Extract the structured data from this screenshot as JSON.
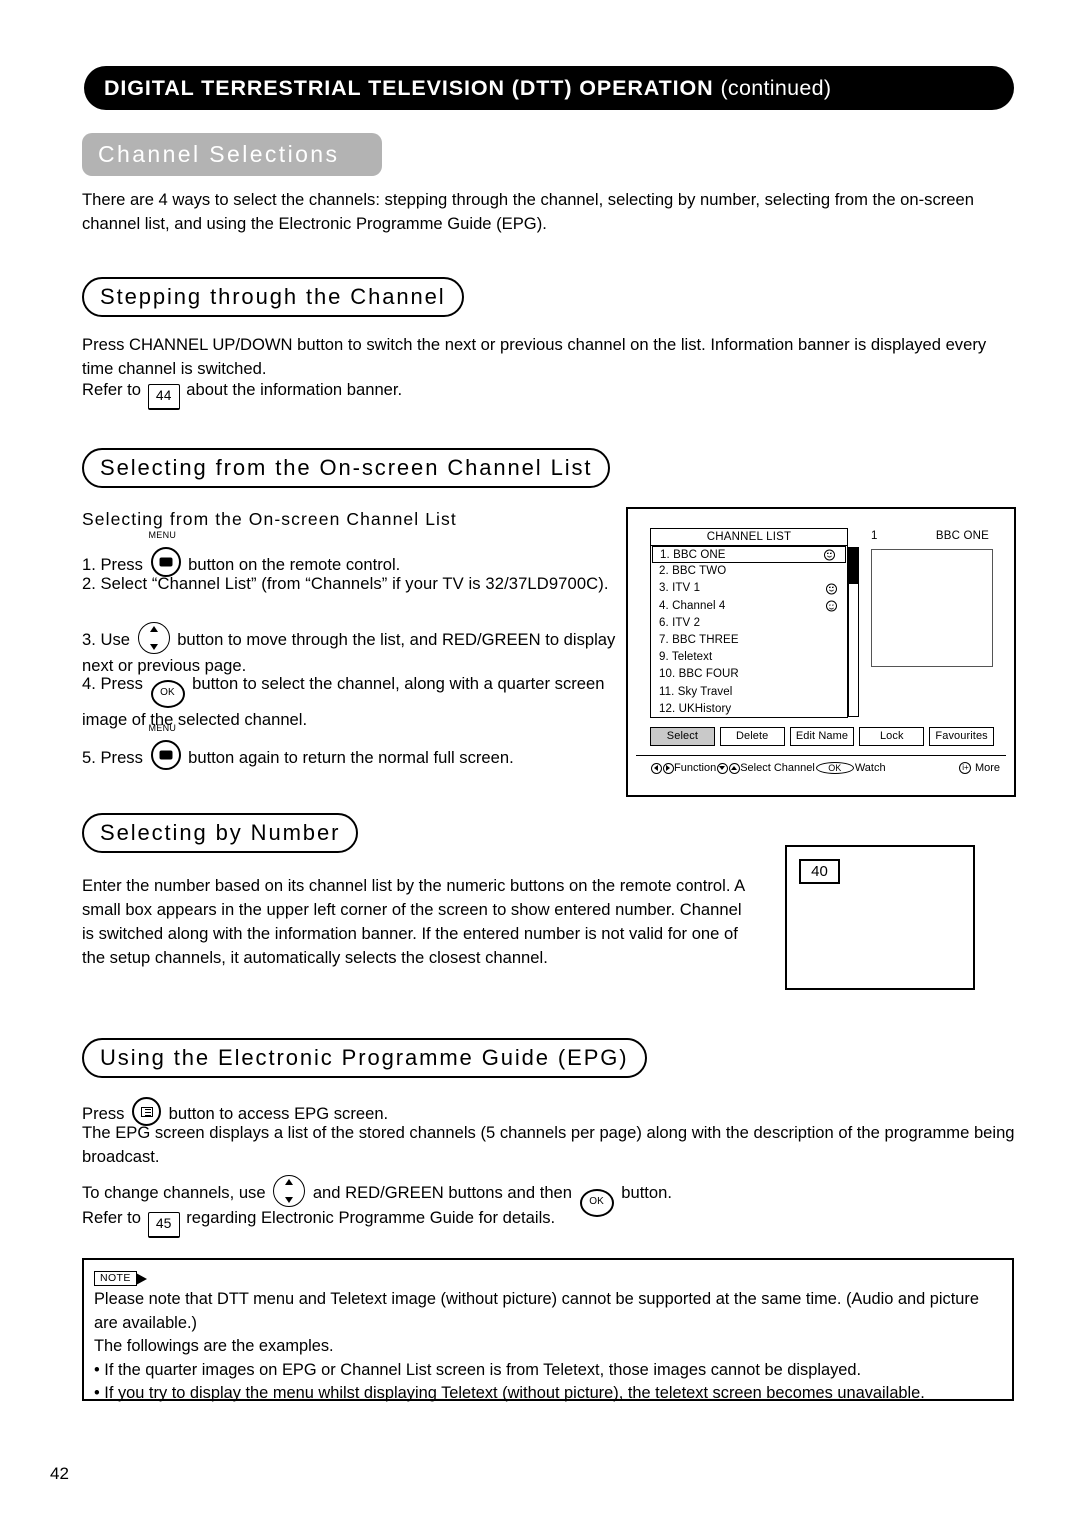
{
  "header": {
    "title_main": "DIGITAL TERRESTRIAL TELEVISION (DTT) OPERATION ",
    "title_tail": "(continued)"
  },
  "gray_heading": "Channel Selections",
  "intro": "There are 4 ways to select the channels: stepping through the channel, selecting by number, selecting from the on-screen channel list, and using the Electronic Programme Guide (EPG).",
  "sections": {
    "stepping": {
      "heading": "Stepping through the Channel",
      "para1": "Press CHANNEL UP/DOWN button to switch the next or previous channel on the list. Information banner is displayed every time channel is switched.",
      "refer_prefix": "Refer to ",
      "refer_page": "44",
      "refer_suffix": " about the information banner."
    },
    "onscreen": {
      "heading": "Selecting from the On-screen Channel List",
      "subheading": "Selecting from the On-screen Channel List",
      "steps": [
        {
          "num": "1.",
          "pre": "Press ",
          "icon": "menu-button-icon",
          "icon_caption": "MENU",
          "post": " button on the remote control."
        },
        {
          "num": "2.",
          "pre": "Select “Channel List” (from “Channels” if your TV is 32/37LD9700C).",
          "icon": "",
          "post": ""
        },
        {
          "num": "3.",
          "pre": "Use ",
          "icon": "dpad-button-icon",
          "post": " button to move through the list, and RED/GREEN to display next or previous page."
        },
        {
          "num": "4.",
          "pre": "Press ",
          "icon": "ok-button-icon",
          "post": " button to select the channel, along with a quarter screen image of the selected channel."
        },
        {
          "num": "5.",
          "pre": "Press ",
          "icon": "menu-button-icon",
          "icon_caption": "MENU",
          "post": " button again to return the normal full screen."
        }
      ]
    },
    "by_number": {
      "heading": "Selecting by Number",
      "para": "Enter the number based on its channel list by the numeric buttons on the remote control. A small box appears in the upper left corner of the screen to show entered number. Channel is switched along with the information banner. If the entered number is not valid for one of the setup channels, it automatically selects the closest channel.",
      "screen_badge": "40"
    },
    "epg": {
      "heading": "Using the Electronic Programme Guide (EPG)",
      "line1_pre": "Press ",
      "line1_icon": "epg-button-icon",
      "line1_post": " button to access EPG screen.",
      "line2": "The EPG screen displays a list of the stored channels (5 channels per page) along with the description of the programme being broadcast.",
      "line3_pre": "To change channels, use ",
      "line3_mid": " and RED/GREEN buttons and then ",
      "line3_post": " button.",
      "line4_pre": "Refer to ",
      "line4_page": "45",
      "line4_post": " regarding Electronic Programme Guide for details."
    }
  },
  "tv_screen": {
    "list_title": "CHANNEL LIST",
    "channels": [
      {
        "label": "1. BBC ONE",
        "selected": true,
        "smiley": true
      },
      {
        "label": "2. BBC TWO",
        "selected": false,
        "smiley": false
      },
      {
        "label": "3. ITV 1",
        "selected": false,
        "smiley": true
      },
      {
        "label": "4. Channel 4",
        "selected": false,
        "smiley": true
      },
      {
        "label": "6. ITV 2",
        "selected": false,
        "smiley": false
      },
      {
        "label": "7. BBC THREE",
        "selected": false,
        "smiley": false
      },
      {
        "label": "9. Teletext",
        "selected": false,
        "smiley": false
      },
      {
        "label": "10. BBC FOUR",
        "selected": false,
        "smiley": false
      },
      {
        "label": "11. Sky Travel",
        "selected": false,
        "smiley": false
      },
      {
        "label": "12. UKHistory",
        "selected": false,
        "smiley": false
      }
    ],
    "current_number": "1",
    "current_name": "BBC ONE",
    "buttons": [
      {
        "label": "Select",
        "active": true
      },
      {
        "label": "Delete",
        "active": false
      },
      {
        "label": "Edit Name",
        "active": false
      },
      {
        "label": "Lock",
        "active": false
      },
      {
        "label": "Favourites",
        "active": false
      }
    ],
    "legend": {
      "function": "Function",
      "select_channel": "Select Channel",
      "ok": "OK",
      "watch": "Watch",
      "more": "More",
      "plus": "i+"
    }
  },
  "note": {
    "tag": "NOTE",
    "line1": "Please note that DTT menu and Teletext image (without picture) cannot be supported at the same time. (Audio and picture are available.)",
    "line2": "The followings are the examples.",
    "bullet1": "• If the quarter images on EPG or Channel List screen is from Teletext, those images cannot be displayed.",
    "bullet2": "• If you try to display the menu whilst displaying Teletext (without picture), the teletext screen becomes unavailable."
  },
  "page_number": "42"
}
